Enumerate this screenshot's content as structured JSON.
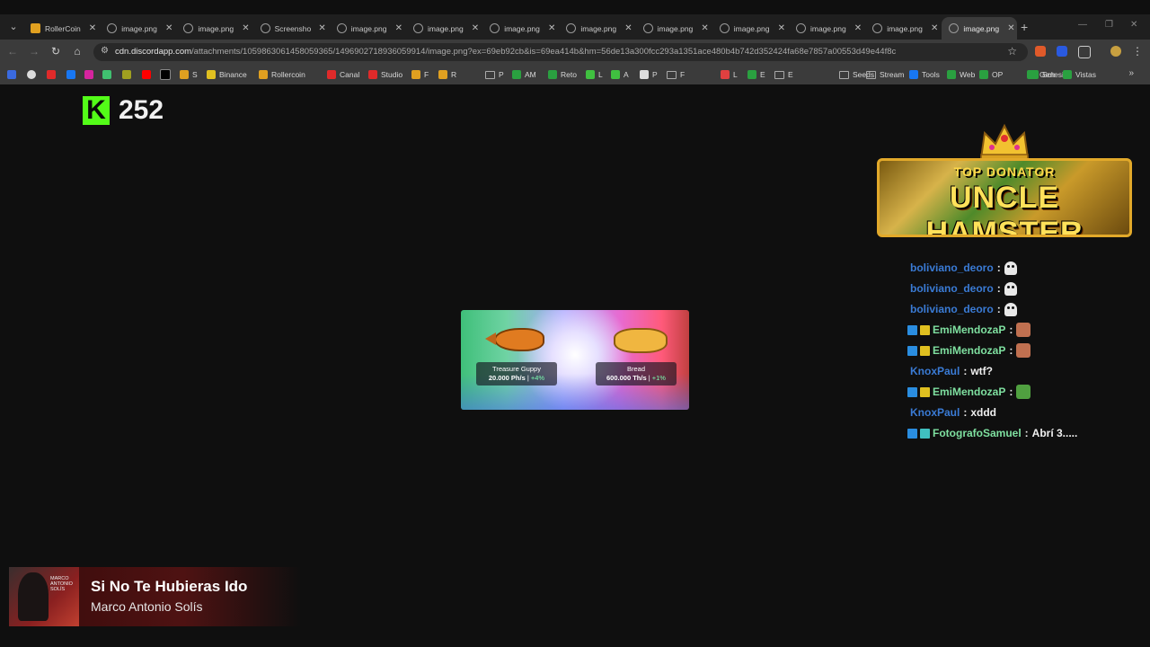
{
  "browser": {
    "tabs": [
      {
        "title": "RollerCoin",
        "active": false
      },
      {
        "title": "image.png",
        "active": false
      },
      {
        "title": "image.png",
        "active": false
      },
      {
        "title": "Screensho",
        "active": false
      },
      {
        "title": "image.png",
        "active": false
      },
      {
        "title": "image.png",
        "active": false
      },
      {
        "title": "image.png",
        "active": false
      },
      {
        "title": "image.png",
        "active": false
      },
      {
        "title": "image.png",
        "active": false
      },
      {
        "title": "image.png",
        "active": false
      },
      {
        "title": "image.png",
        "active": false
      },
      {
        "title": "image.png",
        "active": false
      },
      {
        "title": "image.png",
        "active": true
      }
    ],
    "url_domain": "cdn.discordapp.com",
    "url_path": "/attachments/1059863061458059365/1496902718936059914/image.png?ex=69eb92cb&is=69ea414b&hm=56de13a300fcc293a1351ace480b4b742d352424fa68e7857a00553d49e44f8c",
    "bookmarks": [
      "S",
      "Binance",
      "Rollercoin",
      "Canal",
      "Studio",
      "F",
      "R",
      "P",
      "AM",
      "Reto",
      "L",
      "A",
      "P",
      "F",
      "L",
      "E",
      "E",
      "Seeds",
      "Stream",
      "Tools",
      "Web",
      "OP",
      "Genesis",
      "Sch",
      "Vistas"
    ]
  },
  "stream": {
    "viewer_count": "252",
    "kick_logo": "K",
    "banner": {
      "top": "TOP DONATOR",
      "name": "UNCLE HAMSTER"
    },
    "chat": [
      {
        "user": "boliviano_deoro",
        "color": "#3a7bd5",
        "text": "",
        "emote": "ghost",
        "badges": []
      },
      {
        "user": "boliviano_deoro",
        "color": "#3a7bd5",
        "text": "",
        "emote": "ghost",
        "badges": []
      },
      {
        "user": "boliviano_deoro",
        "color": "#3a7bd5",
        "text": "",
        "emote": "ghost",
        "badges": []
      },
      {
        "user": "EmiMendozaP",
        "color": "#7fe0a0",
        "text": "",
        "emote": "face",
        "badges": [
          "#2a8de0",
          "#e0c020"
        ]
      },
      {
        "user": "EmiMendozaP",
        "color": "#7fe0a0",
        "text": "",
        "emote": "face",
        "badges": [
          "#2a8de0",
          "#e0c020"
        ]
      },
      {
        "user": "KnoxPaul",
        "color": "#3a7bd5",
        "text": "wtf?",
        "emote": "",
        "badges": []
      },
      {
        "user": "EmiMendozaP",
        "color": "#7fe0a0",
        "text": "",
        "emote": "frog",
        "badges": [
          "#2a8de0",
          "#e0c020"
        ]
      },
      {
        "user": "KnoxPaul",
        "color": "#3a7bd5",
        "text": "xddd",
        "emote": "",
        "badges": []
      },
      {
        "user": "FotografoSamuel",
        "color": "#7fe0a0",
        "text": "Abrí 3.....",
        "emote": "",
        "badges": [
          "#2a8de0",
          "#40c0c0"
        ]
      }
    ],
    "popup": {
      "items": [
        {
          "name": "Treasure Guppy",
          "power": "20.000 Ph/s",
          "bonus": "+4%"
        },
        {
          "name": "Bread",
          "power": "600.000 Th/s",
          "bonus": "+1%"
        }
      ]
    },
    "now_playing": {
      "title": "Si No Te Hubieras Ido",
      "artist": "Marco Antonio Solís",
      "album_art_text": "MARCO ANTONIO SOLÍS"
    }
  }
}
